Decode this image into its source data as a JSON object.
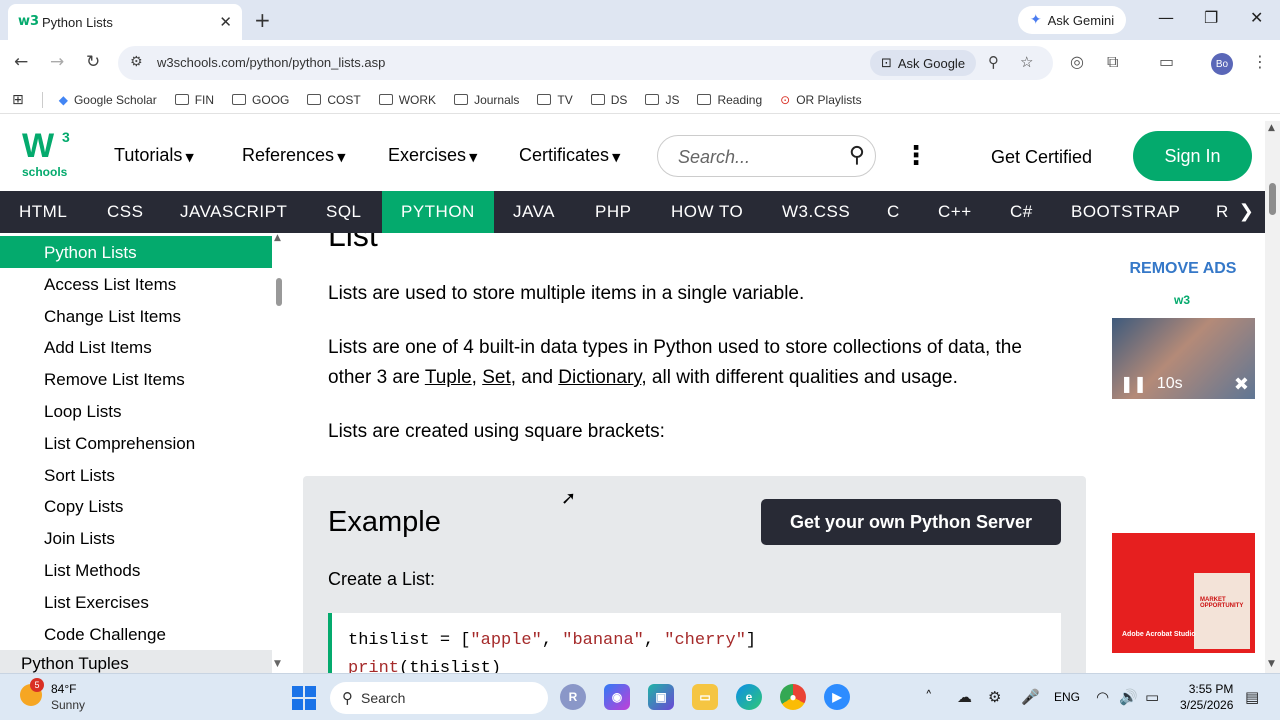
{
  "browser": {
    "tab_title": "Python Lists",
    "tab_favicon": "w3",
    "ask_gemini": "Ask Gemini",
    "url": "w3schools.com/python/python_lists.asp",
    "ask_google": "Ask Google",
    "avatar_initials": "Bo",
    "bookmarks": [
      "Google Scholar",
      "FIN",
      "GOOG",
      "COST",
      "WORK",
      "Journals",
      "TV",
      "DS",
      "JS",
      "Reading",
      "OR Playlists"
    ]
  },
  "site": {
    "logo_main": "W",
    "logo_sup": "3",
    "logo_sub": "schools",
    "menus": [
      "Tutorials",
      "References",
      "Exercises",
      "Certificates"
    ],
    "search_placeholder": "Search...",
    "get_certified": "Get Certified",
    "sign_in": "Sign In",
    "topnav": [
      "HTML",
      "CSS",
      "JAVASCRIPT",
      "SQL",
      "PYTHON",
      "JAVA",
      "PHP",
      "HOW TO",
      "W3.CSS",
      "C",
      "C++",
      "C#",
      "BOOTSTRAP",
      "R"
    ],
    "topnav_active": "PYTHON",
    "accent_color": "#04aa6d"
  },
  "sidebar": {
    "active": "Python Lists",
    "items": [
      "Access List Items",
      "Change List Items",
      "Add List Items",
      "Remove List Items",
      "Loop Lists",
      "List Comprehension",
      "Sort Lists",
      "Copy Lists",
      "Join Lists",
      "List Methods",
      "List Exercises",
      "Code Challenge"
    ],
    "next_section": "Python Tuples"
  },
  "content": {
    "heading": "List",
    "p1": "Lists are used to store multiple items in a single variable.",
    "p2_a": "Lists are one of 4 built-in data types in Python used to store collections of data, the other 3 are ",
    "link_tuple": "Tuple",
    "sep1": ", ",
    "link_set": "Set",
    "sep2": ", and ",
    "link_dict": "Dictionary",
    "p2_b": ", all with different qualities and usage.",
    "p3": "Lists are created using square brackets:",
    "example_title": "Example",
    "example_button": "Get your own Python Server",
    "example_sub": "Create a List:",
    "code_line1_a": "thislist = [",
    "code_str1": "\"apple\"",
    "code_comma1": ", ",
    "code_str2": "\"banana\"",
    "code_comma2": ", ",
    "code_str3": "\"cherry\"",
    "code_line1_b": "]",
    "code_line2_fn": "print",
    "code_line2_rest": "(thislist)"
  },
  "ads": {
    "remove_ads": "REMOVE ADS",
    "ad_logo": "w3",
    "video_timer": "10s",
    "adobe_card": "MARKET OPPORTUNITY",
    "adobe_brand": "Adobe Acrobat Studio"
  },
  "taskbar": {
    "weather_badge": "5",
    "temperature": "84°F",
    "condition": "Sunny",
    "search_label": "Search",
    "language": "ENG",
    "time": "3:55 PM",
    "date": "3/25/2026"
  }
}
